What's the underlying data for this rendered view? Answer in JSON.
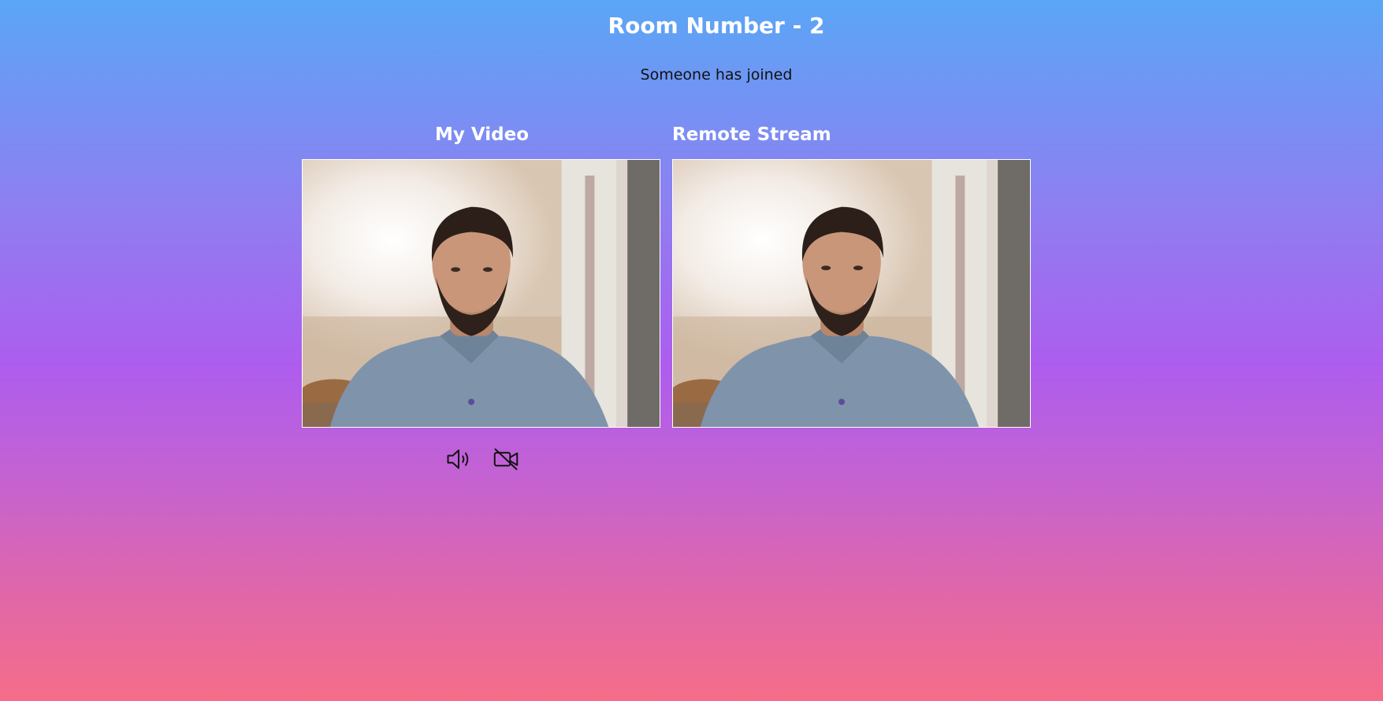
{
  "header": {
    "title": "Room Number - 2",
    "status": "Someone has joined"
  },
  "videos": {
    "local": {
      "label": "My Video"
    },
    "remote": {
      "label": "Remote Stream"
    }
  },
  "controls": {
    "audio_icon": "speaker-icon",
    "video_icon": "video-off-icon"
  },
  "colors": {
    "gradient_top": "#5aa6f6",
    "gradient_mid": "#ad5dee",
    "gradient_bottom": "#f66d88",
    "text_light": "#ffffff",
    "text_dark": "#111111"
  }
}
